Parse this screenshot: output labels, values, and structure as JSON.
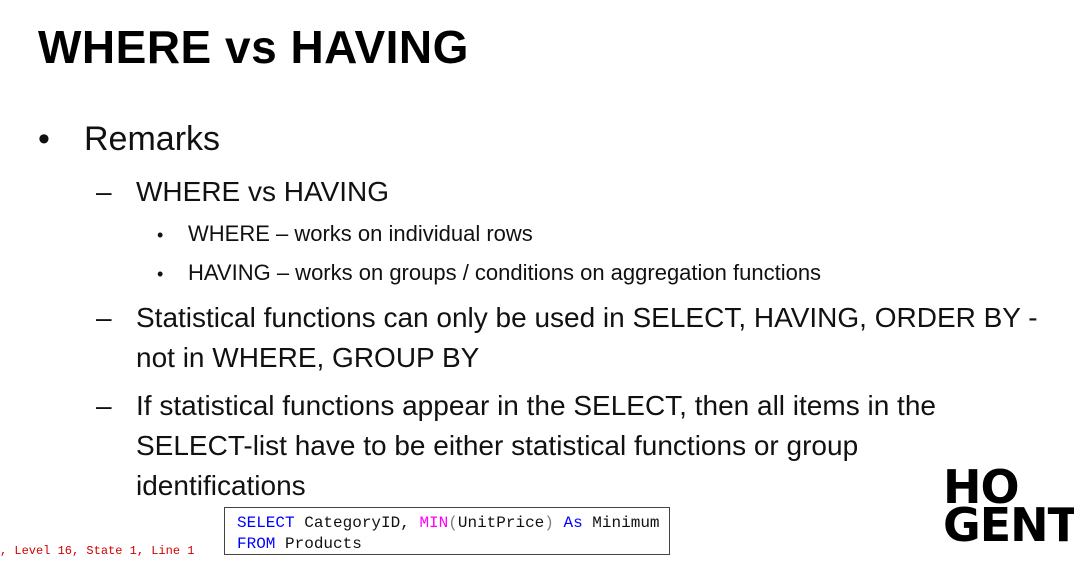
{
  "slide": {
    "title": "WHERE vs HAVING",
    "bullet": "Remarks",
    "points": [
      {
        "text": "WHERE vs HAVING",
        "subpoints": [
          "WHERE – works on individual rows",
          "HAVING – works on groups / conditions on aggregation functions"
        ]
      },
      {
        "text": "Statistical functions can only be used in SELECT, HAVING, ORDER BY - not in WHERE, GROUP BY"
      },
      {
        "text": "If statistical functions appear in the SELECT, then all items in the SELECT-list have to be either statistical functions or group identifications"
      }
    ]
  },
  "glyphs": {
    "bullet": "•",
    "dash": "–",
    "subbullet": "•"
  },
  "logo": {
    "line1": "HO",
    "line2": "GENT"
  },
  "code": {
    "line1": {
      "select": "SELECT",
      "col": " CategoryID, ",
      "fn": "MIN",
      "open": "(",
      "arg": "UnitPrice",
      "close": ")",
      "as": " As",
      "alias": " Minimum"
    },
    "line2": {
      "from": "FROM",
      "table": " Products"
    }
  },
  "error_fragment": ", Level 16, State 1, Line 1"
}
